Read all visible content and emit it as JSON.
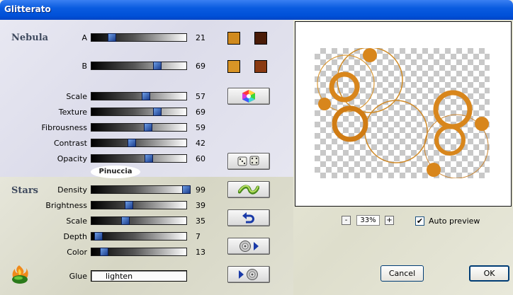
{
  "window": {
    "title": "Glitterato"
  },
  "nebula": {
    "title": "Nebula",
    "sliders": [
      {
        "name": "A",
        "value": 21
      },
      {
        "name": "B",
        "value": 69
      },
      {
        "name": "Scale",
        "value": 57
      },
      {
        "name": "Texture",
        "value": 69
      },
      {
        "name": "Fibrousness",
        "value": 59
      },
      {
        "name": "Contrast",
        "value": 42
      },
      {
        "name": "Opacity",
        "value": 60
      }
    ],
    "colors": {
      "a_left": "#d08a1e",
      "a_right": "#4a1c08",
      "b_left": "#d89426",
      "b_right": "#8a3a12"
    }
  },
  "stars": {
    "title": "Stars",
    "sliders": [
      {
        "name": "Density",
        "value": 99
      },
      {
        "name": "Brightness",
        "value": 39
      },
      {
        "name": "Scale",
        "value": 35
      },
      {
        "name": "Depth",
        "value": 7
      },
      {
        "name": "Color",
        "value": 13
      }
    ]
  },
  "glue": {
    "label": "Glue",
    "value": "lighten"
  },
  "watermark": {
    "text": "Pinuccia"
  },
  "preview": {
    "zoom": "33%",
    "zoom_minus": "-",
    "zoom_plus": "+",
    "auto_preview_label": "Auto preview",
    "auto_preview_checked": true,
    "check_mark": "✔"
  },
  "buttons": {
    "cancel": "Cancel",
    "ok": "OK"
  }
}
